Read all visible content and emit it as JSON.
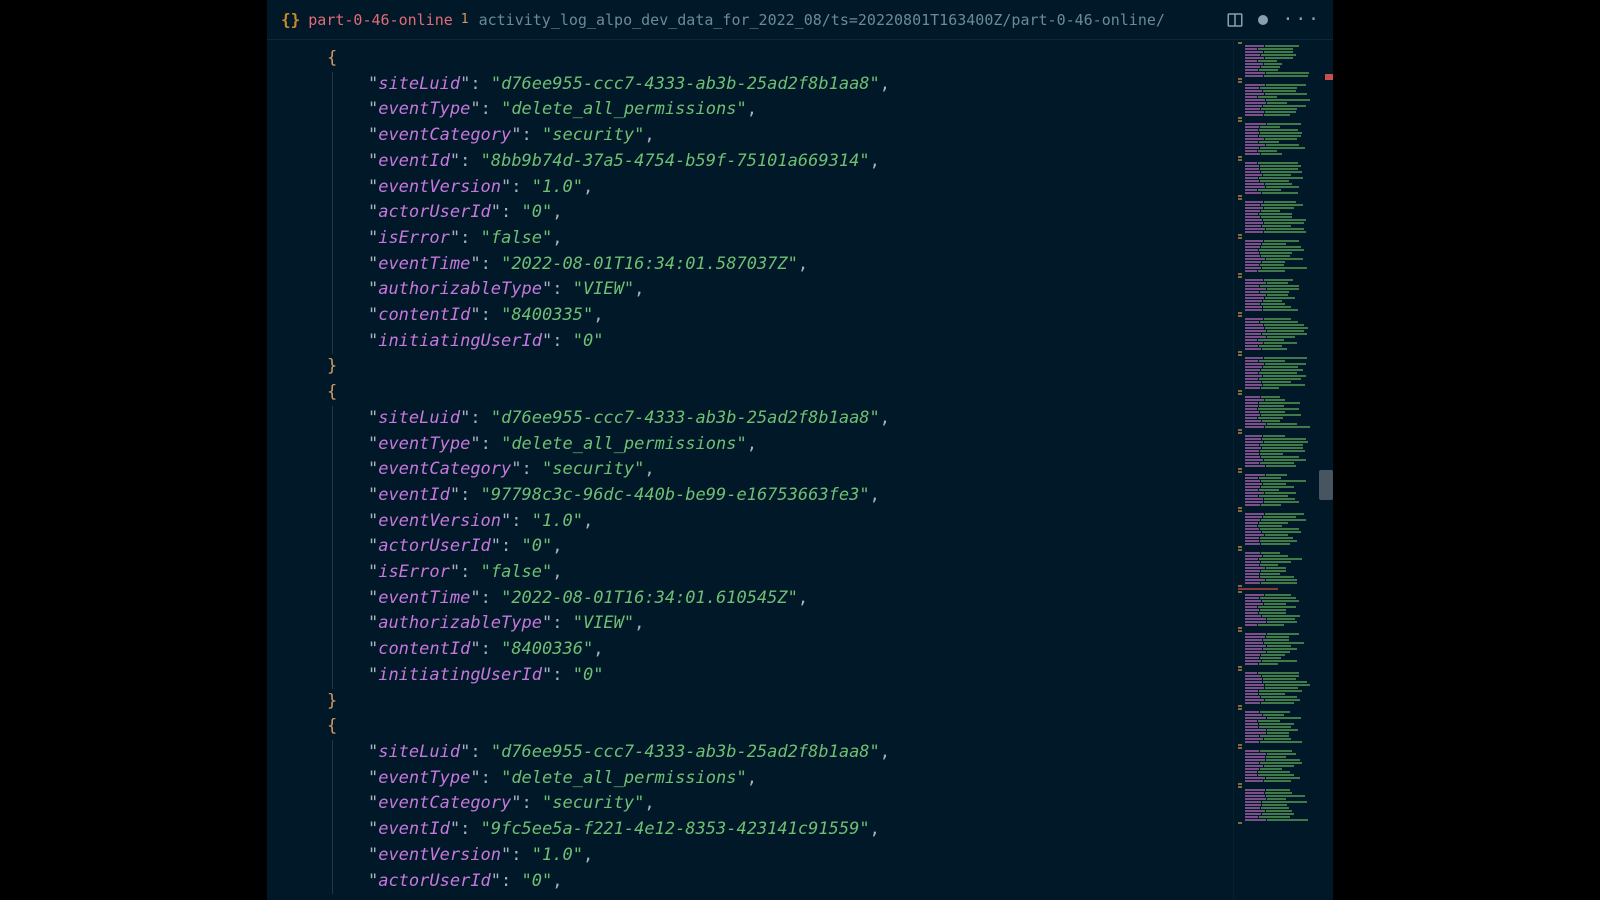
{
  "tab": {
    "icon_label": "{}",
    "title": "part-0-46-online",
    "badge": "1",
    "breadcrumb": "activity_log_alpo_dev_data_for_2022_08/ts=20220801T163400Z/part-0-46-online/"
  },
  "colors": {
    "background": "#001828",
    "key": "#c678dd",
    "string": "#6fbf73",
    "brace": "#d19a66",
    "tab_title": "#e06c75"
  },
  "records": [
    {
      "siteLuid": "d76ee955-ccc7-4333-ab3b-25ad2f8b1aa8",
      "eventType": "delete_all_permissions",
      "eventCategory": "security",
      "eventId": "8bb9b74d-37a5-4754-b59f-75101a669314",
      "eventVersion": "1.0",
      "actorUserId": "0",
      "isError": "false",
      "eventTime": "2022-08-01T16:34:01.587037Z",
      "authorizableType": "VIEW",
      "contentId": "8400335",
      "initiatingUserId": "0"
    },
    {
      "siteLuid": "d76ee955-ccc7-4333-ab3b-25ad2f8b1aa8",
      "eventType": "delete_all_permissions",
      "eventCategory": "security",
      "eventId": "97798c3c-96dc-440b-be99-e16753663fe3",
      "eventVersion": "1.0",
      "actorUserId": "0",
      "isError": "false",
      "eventTime": "2022-08-01T16:34:01.610545Z",
      "authorizableType": "VIEW",
      "contentId": "8400336",
      "initiatingUserId": "0"
    },
    {
      "siteLuid": "d76ee955-ccc7-4333-ab3b-25ad2f8b1aa8",
      "eventType": "delete_all_permissions",
      "eventCategory": "security",
      "eventId": "9fc5ee5a-f221-4e12-8353-423141c91559",
      "eventVersion": "1.0",
      "actorUserId": "0"
    }
  ],
  "minimap": {
    "viewport_top_pct": 50,
    "marker_top_pct": 4
  }
}
